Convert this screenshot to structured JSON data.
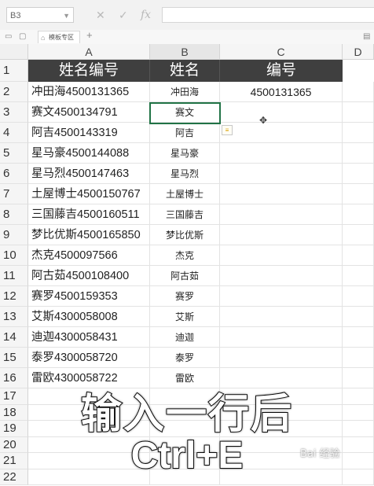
{
  "formula_bar": {
    "cell_ref": "B3",
    "cancel_icon": "✕",
    "confirm_icon": "✓",
    "function_icon": "fx"
  },
  "tab_strip": {
    "active_tab": "模板专区",
    "add_tab": "+"
  },
  "columns": [
    "A",
    "B",
    "C",
    "D"
  ],
  "header_row": {
    "a": "姓名编号",
    "b": "姓名",
    "c": "编号"
  },
  "rows": [
    {
      "num": "1"
    },
    {
      "num": "2",
      "a": "冲田海4500131365",
      "b": "冲田海",
      "c": "4500131365"
    },
    {
      "num": "3",
      "a": "赛文4500134791",
      "b": "赛文",
      "c": ""
    },
    {
      "num": "4",
      "a": "阿吉4500143319",
      "b": "阿吉",
      "c": ""
    },
    {
      "num": "5",
      "a": "星马豪4500144088",
      "b": "星马豪",
      "c": ""
    },
    {
      "num": "6",
      "a": "星马烈4500147463",
      "b": "星马烈",
      "c": ""
    },
    {
      "num": "7",
      "a": "土屋博士4500150767",
      "b": "土屋博士",
      "c": ""
    },
    {
      "num": "8",
      "a": "三国藤吉4500160511",
      "b": "三国藤吉",
      "c": ""
    },
    {
      "num": "9",
      "a": "梦比优斯4500165850",
      "b": "梦比优斯",
      "c": ""
    },
    {
      "num": "10",
      "a": "杰克4500097566",
      "b": "杰克",
      "c": ""
    },
    {
      "num": "11",
      "a": "阿古茹4500108400",
      "b": "阿古茹",
      "c": ""
    },
    {
      "num": "12",
      "a": "赛罗4500159353",
      "b": "赛罗",
      "c": ""
    },
    {
      "num": "13",
      "a": "艾斯4300058008",
      "b": "艾斯",
      "c": ""
    },
    {
      "num": "14",
      "a": "迪迦4300058431",
      "b": "迪迦",
      "c": ""
    },
    {
      "num": "15",
      "a": "泰罗4300058720",
      "b": "泰罗",
      "c": ""
    },
    {
      "num": "16",
      "a": "雷欧4300058722",
      "b": "雷欧",
      "c": ""
    },
    {
      "num": "17"
    },
    {
      "num": "18"
    },
    {
      "num": "19"
    },
    {
      "num": "20"
    },
    {
      "num": "21"
    },
    {
      "num": "22"
    }
  ],
  "caption": {
    "line1": "输入一行后",
    "line2": "Ctrl+E"
  },
  "watermark": "Bai 经验",
  "colors": {
    "header_bg": "#3f3f3f",
    "selection": "#217346"
  }
}
